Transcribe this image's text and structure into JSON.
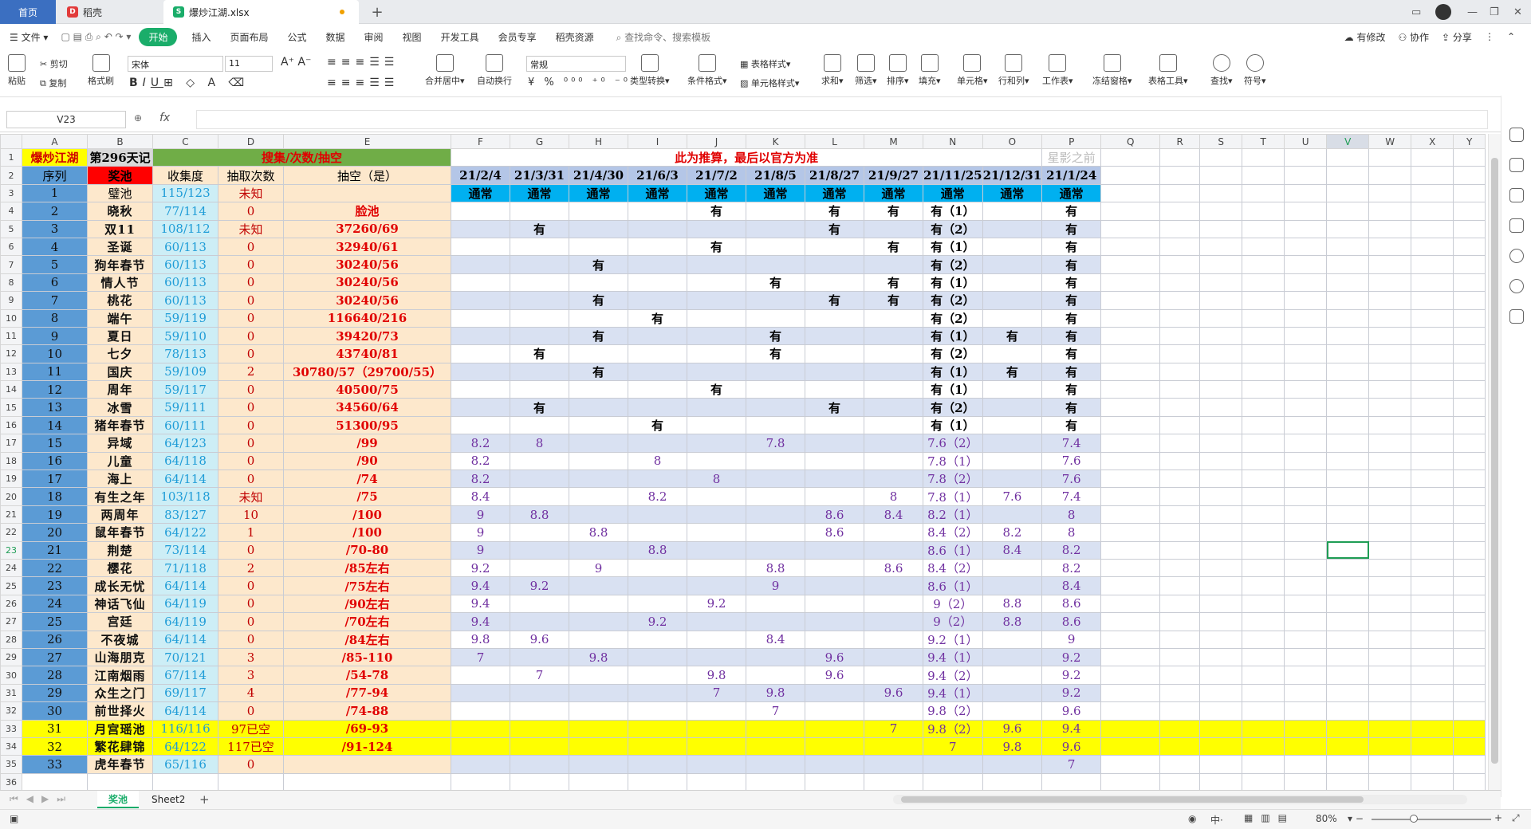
{
  "tabs": {
    "home": "首页",
    "daoke": "稻壳",
    "doc": "爆炒江湖.xlsx",
    "new": "+"
  },
  "menu": {
    "file": "文件",
    "start": "开始",
    "items": [
      "插入",
      "页面布局",
      "公式",
      "数据",
      "审阅",
      "视图",
      "开发工具",
      "会员专享",
      "稻壳资源"
    ],
    "search": "查找命令、搜索模板",
    "modified": "有修改",
    "collab": "协作",
    "share": "分享"
  },
  "ribbon": {
    "paste": "粘贴",
    "cut": "剪切",
    "copy": "复制",
    "format_painter": "格式刷",
    "font_name": "宋体",
    "font_size": "11",
    "merge": "合并居中",
    "wrap": "自动换行",
    "number_format": "常规",
    "type_convert": "类型转换",
    "cond_format": "条件格式",
    "table_style": "表格样式",
    "cell_style": "单元格样式",
    "sum": "求和",
    "filter": "筛选",
    "sort": "排序",
    "fill": "填充",
    "cell": "单元格",
    "rowcol": "行和列",
    "worksheet": "工作表",
    "freeze": "冻结窗格",
    "table_tools": "表格工具",
    "find": "查找",
    "symbol": "符号"
  },
  "formula_bar": {
    "name_box": "V23",
    "fx": "fx",
    "value": ""
  },
  "columns": [
    "A",
    "B",
    "C",
    "D",
    "E",
    "F",
    "G",
    "H",
    "I",
    "J",
    "K",
    "L",
    "M",
    "N",
    "O",
    "P",
    "Q",
    "R",
    "S",
    "T",
    "U",
    "V",
    "W",
    "X",
    "Y"
  ],
  "title_row": {
    "a": "爆炒江湖",
    "b": "第296天记",
    "cde": "搜集/次数/抽空",
    "note": "此为推算，最后以官方为准",
    "watermark": "星影之前"
  },
  "header_row": {
    "a": "序列",
    "b": "奖池",
    "c": "收集度",
    "d": "抽取次数",
    "e": "抽空（是）",
    "dates": [
      "21/2/4",
      "21/3/31",
      "21/4/30",
      "21/6/3",
      "21/7/2",
      "21/8/5",
      "21/8/27",
      "21/9/27",
      "21/11/25",
      "21/12/31",
      "21/1/24"
    ]
  },
  "type_row": {
    "a": "1",
    "b": "璧池",
    "c": "115/123",
    "d": "未知",
    "e": "",
    "values": [
      "通常",
      "通常",
      "通常",
      "通常",
      "通常",
      "通常",
      "通常",
      "通常",
      "通常",
      "通常",
      "通常"
    ]
  },
  "rows": [
    {
      "r": "4",
      "a": "2",
      "b": "晓秋",
      "c": "77/114",
      "d": "0",
      "e": "脸池",
      "f": [
        "",
        "",
        "",
        "",
        "有",
        "",
        "有",
        "有",
        "有（1）",
        "",
        "有"
      ]
    },
    {
      "r": "5",
      "a": "3",
      "b": "双11",
      "c": "108/112",
      "d": "未知",
      "e": "37260/69",
      "f": [
        "",
        "有",
        "",
        "",
        "",
        "",
        "有",
        "",
        "有（2）",
        "",
        "有"
      ]
    },
    {
      "r": "6",
      "a": "4",
      "b": "圣诞",
      "c": "60/113",
      "d": "0",
      "e": "32940/61",
      "f": [
        "",
        "",
        "",
        "",
        "有",
        "",
        "",
        "有",
        "有（1）",
        "",
        "有"
      ]
    },
    {
      "r": "7",
      "a": "5",
      "b": "狗年春节",
      "c": "60/113",
      "d": "0",
      "e": "30240/56",
      "f": [
        "",
        "",
        "有",
        "",
        "",
        "",
        "",
        "",
        "有（2）",
        "",
        "有"
      ]
    },
    {
      "r": "8",
      "a": "6",
      "b": "情人节",
      "c": "60/113",
      "d": "0",
      "e": "30240/56",
      "f": [
        "",
        "",
        "",
        "",
        "",
        "有",
        "",
        "有",
        "有（1）",
        "",
        "有"
      ]
    },
    {
      "r": "9",
      "a": "7",
      "b": "桃花",
      "c": "60/113",
      "d": "0",
      "e": "30240/56",
      "f": [
        "",
        "",
        "有",
        "",
        "",
        "",
        "有",
        "有",
        "有（2）",
        "",
        "有"
      ]
    },
    {
      "r": "10",
      "a": "8",
      "b": "端午",
      "c": "59/119",
      "d": "0",
      "e": "116640/216",
      "f": [
        "",
        "",
        "",
        "有",
        "",
        "",
        "",
        "",
        "有（2）",
        "",
        "有"
      ]
    },
    {
      "r": "11",
      "a": "9",
      "b": "夏日",
      "c": "59/110",
      "d": "0",
      "e": "39420/73",
      "f": [
        "",
        "",
        "有",
        "",
        "",
        "有",
        "",
        "",
        "有（1）",
        "有",
        "有"
      ]
    },
    {
      "r": "12",
      "a": "10",
      "b": "七夕",
      "c": "78/113",
      "d": "0",
      "e": "43740/81",
      "f": [
        "",
        "有",
        "",
        "",
        "",
        "有",
        "",
        "",
        "有（2）",
        "",
        "有"
      ]
    },
    {
      "r": "13",
      "a": "11",
      "b": "国庆",
      "c": "59/109",
      "d": "2",
      "e": "30780/57（29700/55）",
      "f": [
        "",
        "",
        "有",
        "",
        "",
        "",
        "",
        "",
        "有（1）",
        "有",
        "有"
      ]
    },
    {
      "r": "14",
      "a": "12",
      "b": "周年",
      "c": "59/117",
      "d": "0",
      "e": "40500/75",
      "f": [
        "",
        "",
        "",
        "",
        "有",
        "",
        "",
        "",
        "有（1）",
        "",
        "有"
      ]
    },
    {
      "r": "15",
      "a": "13",
      "b": "冰雪",
      "c": "59/111",
      "d": "0",
      "e": "34560/64",
      "f": [
        "",
        "有",
        "",
        "",
        "",
        "",
        "有",
        "",
        "有（2）",
        "",
        "有"
      ]
    },
    {
      "r": "16",
      "a": "14",
      "b": "猪年春节",
      "c": "60/111",
      "d": "0",
      "e": "51300/95",
      "f": [
        "",
        "",
        "",
        "有",
        "",
        "",
        "",
        "",
        "有（1）",
        "",
        "有"
      ]
    },
    {
      "r": "17",
      "a": "15",
      "b": "异域",
      "c": "64/123",
      "d": "0",
      "e": "/99",
      "f": [
        "8.2",
        "8",
        "",
        "",
        "",
        "7.8",
        "",
        "",
        "7.6（2）",
        "",
        "7.4"
      ]
    },
    {
      "r": "18",
      "a": "16",
      "b": "儿童",
      "c": "64/118",
      "d": "0",
      "e": "/90",
      "f": [
        "8.2",
        "",
        "",
        "8",
        "",
        "",
        "",
        "",
        "7.8（1）",
        "",
        "7.6"
      ]
    },
    {
      "r": "19",
      "a": "17",
      "b": "海上",
      "c": "64/114",
      "d": "0",
      "e": "/74",
      "f": [
        "8.2",
        "",
        "",
        "",
        "8",
        "",
        "",
        "",
        "7.8（2）",
        "",
        "7.6"
      ]
    },
    {
      "r": "20",
      "a": "18",
      "b": "有生之年",
      "c": "103/118",
      "d": "未知",
      "e": "/75",
      "f": [
        "8.4",
        "",
        "",
        "8.2",
        "",
        "",
        "",
        "8",
        "7.8（1）",
        "7.6",
        "7.4"
      ]
    },
    {
      "r": "21",
      "a": "19",
      "b": "两周年",
      "c": "83/127",
      "d": "10",
      "e": "/100",
      "f": [
        "9",
        "8.8",
        "",
        "",
        "",
        "",
        "8.6",
        "8.4",
        "8.2（1）",
        "",
        "8"
      ]
    },
    {
      "r": "22",
      "a": "20",
      "b": "鼠年春节",
      "c": "64/122",
      "d": "1",
      "e": "/100",
      "f": [
        "9",
        "",
        "8.8",
        "",
        "",
        "",
        "8.6",
        "",
        "8.4（2）",
        "8.2",
        "8"
      ]
    },
    {
      "r": "23",
      "a": "21",
      "b": "荆楚",
      "c": "73/114",
      "d": "0",
      "e": "/70-80",
      "f": [
        "9",
        "",
        "",
        "8.8",
        "",
        "",
        "",
        "",
        "8.6（1）",
        "8.4",
        "8.2"
      ]
    },
    {
      "r": "24",
      "a": "22",
      "b": "樱花",
      "c": "71/118",
      "d": "2",
      "e": "/85左右",
      "f": [
        "9.2",
        "",
        "9",
        "",
        "",
        "8.8",
        "",
        "8.6",
        "8.4（2）",
        "",
        "8.2"
      ]
    },
    {
      "r": "25",
      "a": "23",
      "b": "成长无忧",
      "c": "64/114",
      "d": "0",
      "e": "/75左右",
      "f": [
        "9.4",
        "9.2",
        "",
        "",
        "",
        "9",
        "",
        "",
        "8.6（1）",
        "",
        "8.4"
      ]
    },
    {
      "r": "26",
      "a": "24",
      "b": "神话飞仙",
      "c": "64/119",
      "d": "0",
      "e": "/90左右",
      "f": [
        "9.4",
        "",
        "",
        "",
        "9.2",
        "",
        "",
        "",
        "9（2）",
        "8.8",
        "8.6"
      ]
    },
    {
      "r": "27",
      "a": "25",
      "b": "宫廷",
      "c": "64/119",
      "d": "0",
      "e": "/70左右",
      "f": [
        "9.4",
        "",
        "",
        "9.2",
        "",
        "",
        "",
        "",
        "9（2）",
        "8.8",
        "8.6"
      ]
    },
    {
      "r": "28",
      "a": "26",
      "b": "不夜城",
      "c": "64/114",
      "d": "0",
      "e": "/84左右",
      "f": [
        "9.8",
        "9.6",
        "",
        "",
        "",
        "8.4",
        "",
        "",
        "9.2（1）",
        "",
        "9"
      ]
    },
    {
      "r": "29",
      "a": "27",
      "b": "山海朋克",
      "c": "70/121",
      "d": "3",
      "e": "/85-110",
      "f": [
        "7",
        "",
        "9.8",
        "",
        "",
        "",
        "9.6",
        "",
        "9.4（1）",
        "",
        "9.2"
      ]
    },
    {
      "r": "30",
      "a": "28",
      "b": "江南烟雨",
      "c": "67/114",
      "d": "3",
      "e": "/54-78",
      "f": [
        "",
        "7",
        "",
        "",
        "9.8",
        "",
        "9.6",
        "",
        "9.4（2）",
        "",
        "9.2"
      ]
    },
    {
      "r": "31",
      "a": "29",
      "b": "众生之门",
      "c": "69/117",
      "d": "4",
      "e": "/77-94",
      "f": [
        "",
        "",
        "",
        "",
        "7",
        "9.8",
        "",
        "9.6",
        "9.4（1）",
        "",
        "9.2"
      ]
    },
    {
      "r": "32",
      "a": "30",
      "b": "前世择火",
      "c": "64/114",
      "d": "0",
      "e": "/74-88",
      "f": [
        "",
        "",
        "",
        "",
        "",
        "7",
        "",
        "",
        "9.8（2）",
        "",
        "9.6"
      ]
    },
    {
      "r": "33",
      "a": "31",
      "b": "月宫瑶池",
      "c": "116/116",
      "d": "97已空",
      "e": "/69-93",
      "hl": true,
      "f": [
        "",
        "",
        "",
        "",
        "",
        "",
        "",
        "7",
        "9.8（2）",
        "9.6",
        "9.4"
      ]
    },
    {
      "r": "34",
      "a": "32",
      "b": "繁花肆锦",
      "c": "64/122",
      "d": "117已空",
      "e": "/91-124",
      "hl": true,
      "f": [
        "",
        "",
        "",
        "",
        "",
        "",
        "",
        "",
        "7",
        "9.8",
        "9.6"
      ]
    },
    {
      "r": "35",
      "a": "33",
      "b": "虎年春节",
      "c": "65/116",
      "d": "0",
      "e": "",
      "f": [
        "",
        "",
        "",
        "",
        "",
        "",
        "",
        "",
        "",
        "",
        "7"
      ]
    },
    {
      "r": "36",
      "a": "",
      "b": "",
      "c": "",
      "d": "",
      "e": "",
      "f": [
        "",
        "",
        "",
        "",
        "",
        "",
        "",
        "",
        "",
        "",
        ""
      ]
    }
  ],
  "sheets": [
    "奖池",
    "Sheet2"
  ],
  "status": {
    "zoom": "80%",
    "ime": "中"
  },
  "colors": {
    "accent": "#1aad6a",
    "seq_blue": "#5b9bd5",
    "pool_red": "#ff0000",
    "highlight_yellow": "#ffff00",
    "band_blue": "#d9e1f2",
    "header_blue": "#b4c6e7",
    "type_cyan": "#00b0f0"
  }
}
